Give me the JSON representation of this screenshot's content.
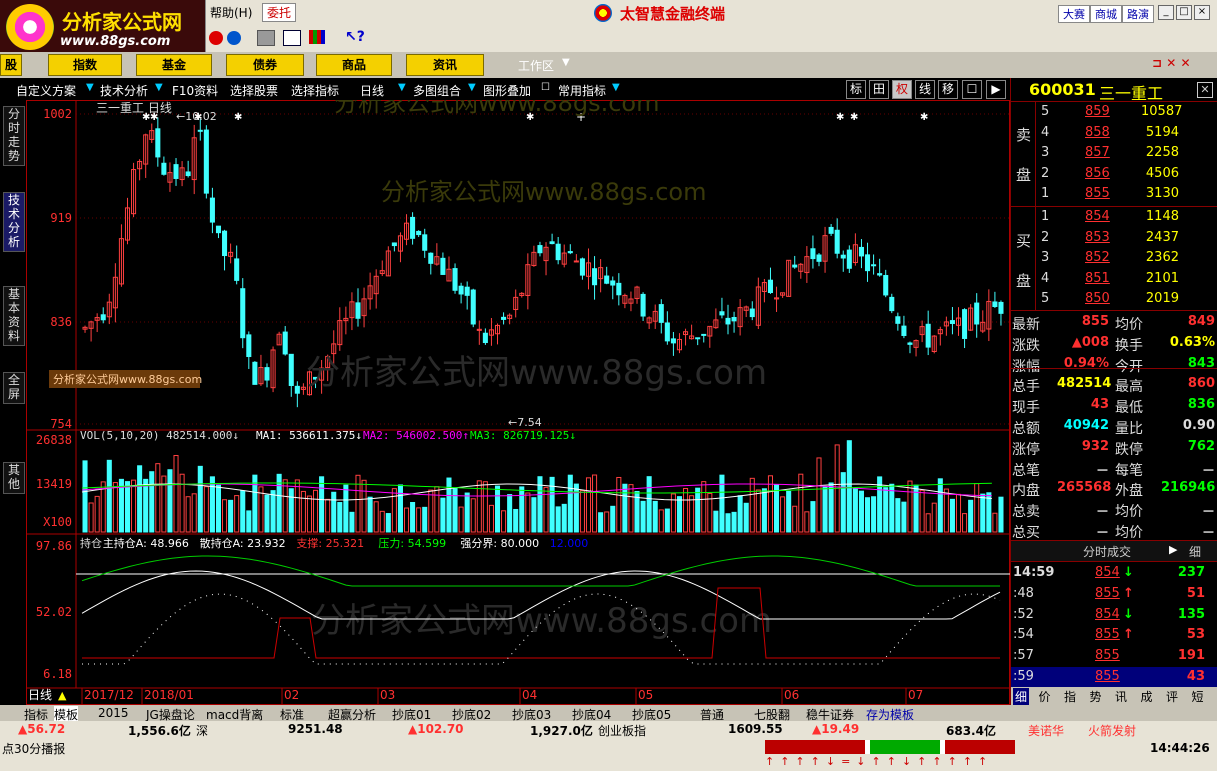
{
  "header": {
    "logo_title": "分析家公式网",
    "logo_url": "www.88gs.com",
    "menu_help": "帮助(H)",
    "entrust_btn": "委托",
    "brand": "太智慧金融终端",
    "right_btns": [
      "大赛",
      "商城",
      "路演"
    ]
  },
  "nav": {
    "items": [
      "股",
      "指数",
      "基金",
      "债券",
      "商品",
      "资讯"
    ],
    "workspace": "工作区"
  },
  "subbar": {
    "items": [
      "自定义方案",
      "技术分析",
      "F10资料",
      "选择股票",
      "选择指标",
      "日线",
      "多图组合",
      "图形叠加",
      "常用指标"
    ],
    "right_btns": [
      "标",
      "田",
      "权",
      "线",
      "移",
      "☐",
      "▶"
    ]
  },
  "left_tabs": [
    "分时走势",
    "技术分析",
    "基本资料",
    "全屏",
    "其他"
  ],
  "chart_data": {
    "type": "candlestick",
    "title": "三一重工 日线",
    "price_axis": [
      "1002",
      "919",
      "836",
      "754"
    ],
    "high_mark": "10.02",
    "low_mark": "7.54",
    "vol_line": "VOL(5,10,20) 482514.000",
    "vol_ma": [
      "MA1: 536611.375",
      "MA2: 546002.500",
      "MA3: 826719.125"
    ],
    "vol_axis": [
      "26838",
      "13419",
      "X100"
    ],
    "ind_line": [
      "持仓",
      "主持仓A: 48.966",
      "散持仓A: 23.932",
      "支撑: 25.321",
      "压力: 54.599",
      "强分界: 80.000",
      "12.000"
    ],
    "ind_axis": [
      "97.86",
      "52.02",
      "6.18"
    ],
    "months": [
      "2017/12",
      "2018/01",
      "02",
      "03",
      "04",
      "05",
      "06",
      "07"
    ],
    "period_label": "日线",
    "watermark": "分析家公式网www.88gs.com",
    "watermark_box": "分析家公式网www.88gs.com"
  },
  "quote": {
    "code": "600031",
    "name": "三一重工",
    "sell_label": [
      "卖",
      "盘"
    ],
    "buy_label": [
      "买",
      "盘"
    ],
    "asks": [
      [
        "5",
        "859",
        "10587"
      ],
      [
        "4",
        "858",
        "5194"
      ],
      [
        "3",
        "857",
        "2258"
      ],
      [
        "2",
        "856",
        "4506"
      ],
      [
        "1",
        "855",
        "3130"
      ]
    ],
    "bids": [
      [
        "1",
        "854",
        "1148"
      ],
      [
        "2",
        "853",
        "2437"
      ],
      [
        "3",
        "852",
        "2362"
      ],
      [
        "4",
        "851",
        "2101"
      ],
      [
        "5",
        "850",
        "2019"
      ]
    ],
    "stats": [
      [
        "最新",
        "855",
        "均价",
        "849"
      ],
      [
        "涨跌",
        "▲008",
        "换手",
        "0.63%"
      ],
      [
        "涨幅",
        "0.94%",
        "今开",
        "843"
      ],
      [
        "总手",
        "482514",
        "最高",
        "860"
      ],
      [
        "现手",
        "43",
        "最低",
        "836"
      ],
      [
        "总额",
        "40942",
        "量比",
        "0.90"
      ],
      [
        "涨停",
        "932",
        "跌停",
        "762"
      ],
      [
        "总笔",
        "－",
        "每笔",
        "－"
      ],
      [
        "内盘",
        "265568",
        "外盘",
        "216946"
      ],
      [
        "总卖",
        "－",
        "均价",
        "－"
      ],
      [
        "总买",
        "－",
        "均价",
        "－"
      ]
    ],
    "ticks_title": "分时成交",
    "ticks_tab": "细",
    "ticks": [
      [
        "14:59",
        "854",
        "↓",
        "237"
      ],
      [
        ":48",
        "855",
        "↑",
        "51"
      ],
      [
        ":52",
        "854",
        "↓",
        "135"
      ],
      [
        ":54",
        "855",
        "↑",
        "53"
      ],
      [
        ":57",
        "855",
        "",
        "191"
      ],
      [
        ":59",
        "855",
        "",
        "43"
      ]
    ],
    "bottom_tabs": [
      "细",
      "价",
      "指",
      "势",
      "讯",
      "成",
      "评",
      "短"
    ]
  },
  "bottom_tabs": [
    "指标",
    "模板",
    "2015",
    "JG操盘论",
    "macd背离",
    "标准",
    "超赢分析",
    "抄底01",
    "抄底02",
    "抄底03",
    "抄底04",
    "抄底05",
    "普通",
    "七股翻",
    "稳牛证券",
    "存为模板"
  ],
  "status": {
    "items": [
      "▲56.72",
      "1,556.6亿",
      "深",
      "9251.48",
      "▲102.70",
      "1,927.0亿",
      "创业板指",
      "1609.55",
      "▲19.49",
      "683.4亿",
      "美诺华",
      "火箭发射"
    ],
    "ticker": "点30分播报",
    "time": "14:44:26"
  }
}
